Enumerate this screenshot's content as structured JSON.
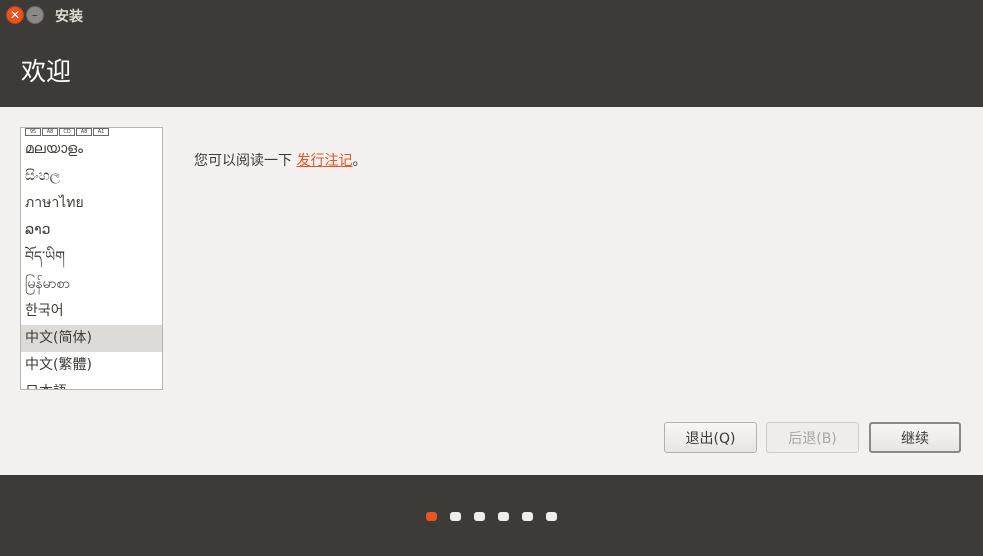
{
  "window": {
    "title": "安装"
  },
  "header": {
    "title": "欢迎"
  },
  "languages": {
    "fragment_glyphs": [
      "95",
      "A8",
      "CD",
      "A8",
      "A1"
    ],
    "items": [
      {
        "label": "മലയാളം",
        "selected": false
      },
      {
        "label": "සිංහල",
        "selected": false
      },
      {
        "label": "ภาษาไทย",
        "selected": false
      },
      {
        "label": "ລາວ",
        "selected": false
      },
      {
        "label": "བོད་ཡིག",
        "selected": false
      },
      {
        "label": "မြန်မာစာ",
        "selected": false
      },
      {
        "label": "한국어",
        "selected": false
      },
      {
        "label": "中文(简体)",
        "selected": true
      },
      {
        "label": "中文(繁體)",
        "selected": false
      },
      {
        "label": "日本語",
        "selected": false
      }
    ]
  },
  "main": {
    "text_prefix": "您可以阅读一下 ",
    "link": "发行注记",
    "text_suffix": "。"
  },
  "buttons": {
    "quit": "退出(Q)",
    "back": "后退(B)",
    "continue": "继续"
  },
  "progress": {
    "total_steps": 6,
    "current_step": 1
  }
}
